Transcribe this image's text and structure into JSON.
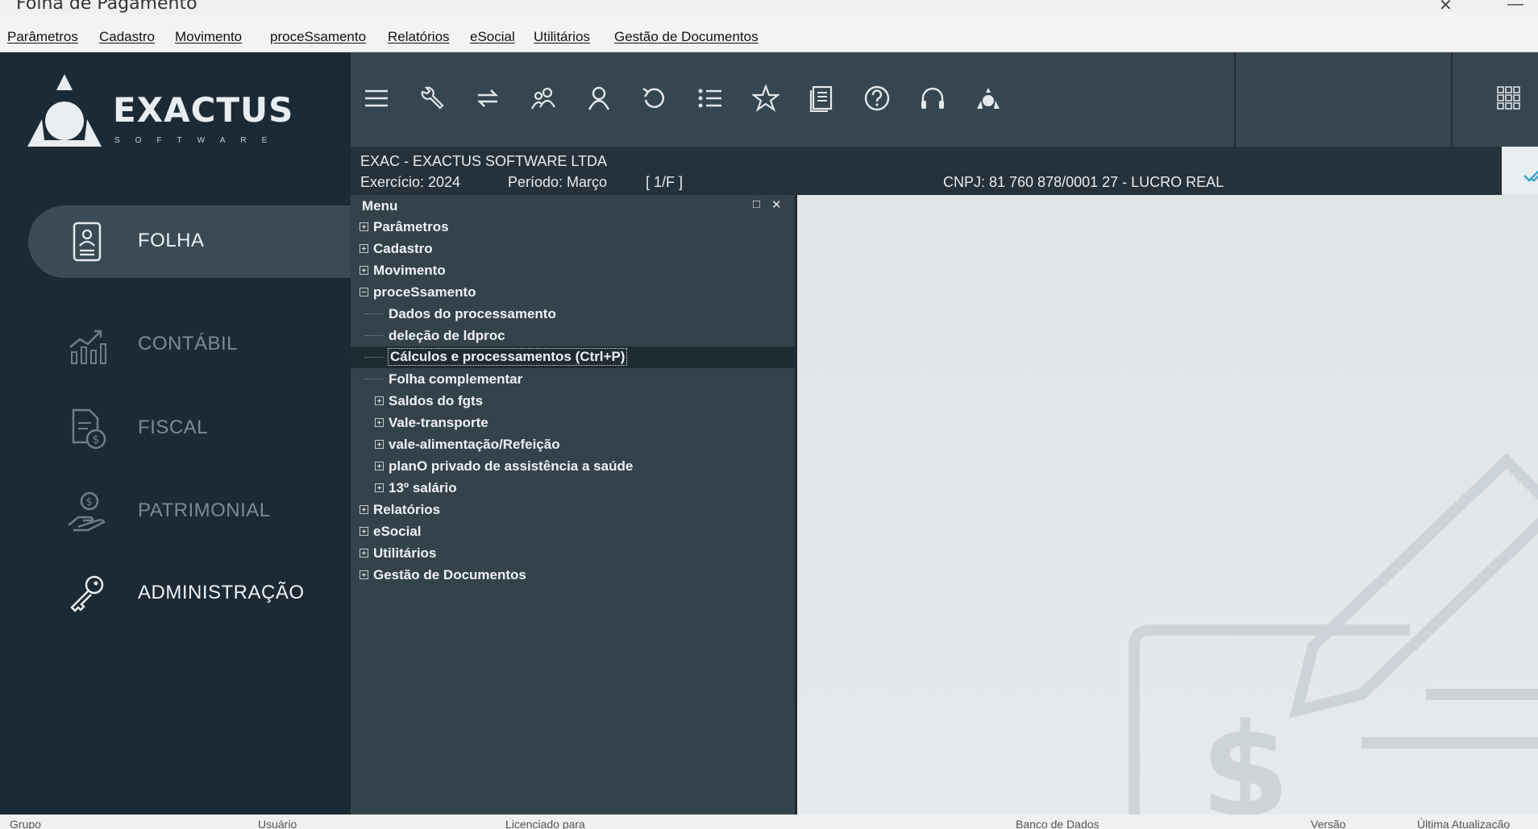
{
  "window": {
    "title": "Folha de Pagamento",
    "close_glyph": "✕",
    "minimize_glyph": "—"
  },
  "menubar": {
    "items": [
      "Parâmetros",
      "Cadastro",
      "Movimento",
      "proceSsamento",
      "Relatórios",
      "eSocial",
      "Utilitários",
      "Gestão de Documentos"
    ]
  },
  "sidebar": {
    "logo_text": "EXACTUS",
    "logo_sub": "SOFTWARE",
    "modules": [
      {
        "label": "FOLHA",
        "icon": "payroll-document-icon",
        "active": true
      },
      {
        "label": "CONTÁBIL",
        "icon": "growth-chart-icon",
        "active": false
      },
      {
        "label": "FISCAL",
        "icon": "tax-document-icon",
        "active": false
      },
      {
        "label": "PATRIMONIAL",
        "icon": "hand-coin-icon",
        "active": false
      },
      {
        "label": "ADMINISTRAÇÃO",
        "icon": "key-icon",
        "active": false
      }
    ]
  },
  "toolbar": {
    "icons": [
      "menu-icon",
      "wrench-icon",
      "swap-icon",
      "users-icon",
      "user-icon",
      "undo-icon",
      "list-icon",
      "star-icon",
      "report-icon",
      "help-icon",
      "headset-icon",
      "exactus-logo-icon"
    ],
    "grid_icon": "apps-grid-icon"
  },
  "info": {
    "company": "EXAC - EXACTUS SOFTWARE LTDA",
    "exercicio": "Exercício: 2024",
    "periodo": "Período: Março",
    "page": "[ 1/F ]",
    "cnpj": "CNPJ: 81 760 878/0001 27 - LUCRO REAL"
  },
  "panel": {
    "title": "Menu",
    "restore_glyph": "□",
    "close_glyph": "✕",
    "tree": [
      {
        "label": "Parâmetros",
        "level": 0,
        "expander": "plus"
      },
      {
        "label": "Cadastro",
        "level": 0,
        "expander": "plus"
      },
      {
        "label": "Movimento",
        "level": 0,
        "expander": "plus"
      },
      {
        "label": "proceSsamento",
        "level": 0,
        "expander": "minus"
      },
      {
        "label": "Dados do processamento",
        "level": 1,
        "expander": "none"
      },
      {
        "label": "deleção de ldproc",
        "level": 1,
        "expander": "none"
      },
      {
        "label": "Cálculos e processamentos  (Ctrl+P)",
        "level": 1,
        "expander": "none",
        "selected": true
      },
      {
        "label": "Folha complementar",
        "level": 1,
        "expander": "none"
      },
      {
        "label": "Saldos do fgts",
        "level": 1,
        "expander": "plus"
      },
      {
        "label": "Vale-transporte",
        "level": 1,
        "expander": "plus"
      },
      {
        "label": "vale-alimentação/Refeição",
        "level": 1,
        "expander": "plus"
      },
      {
        "label": "planO privado de assistência a saúde",
        "level": 1,
        "expander": "plus"
      },
      {
        "label": "13º salário",
        "level": 1,
        "expander": "plus"
      },
      {
        "label": "Relatórios",
        "level": 0,
        "expander": "plus"
      },
      {
        "label": "eSocial",
        "level": 0,
        "expander": "plus"
      },
      {
        "label": "Utilitários",
        "level": 0,
        "expander": "plus"
      },
      {
        "label": "Gestão de Documentos",
        "level": 0,
        "expander": "plus"
      }
    ]
  },
  "statusbar": {
    "items": [
      "Grupo",
      "Usuário",
      "Licenciado para",
      "Banco de Dados",
      "Versão",
      "Última Atualização"
    ]
  },
  "colors": {
    "sidebar_bg": "#1c2a35",
    "toolbar_bg": "#364651",
    "panel_bg": "#34424c",
    "active_module_bg": "#3b4a55",
    "accent_check": "#3aa6c9"
  }
}
